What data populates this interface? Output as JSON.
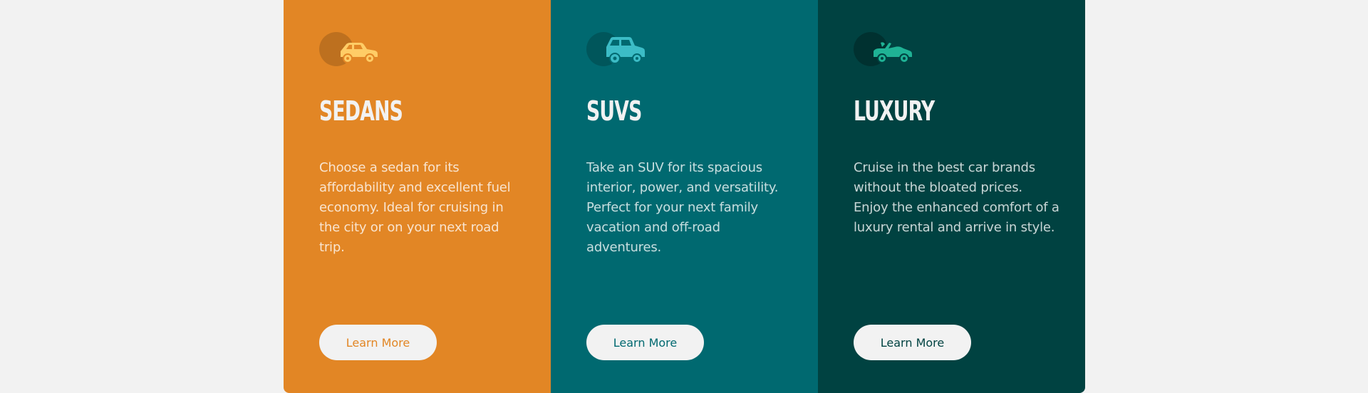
{
  "cards": [
    {
      "id": "sedans",
      "icon": "sedan-car-icon",
      "title": "SEDANS",
      "text": "Choose a sedan for its affordability and excellent fuel economy. Ideal for cruising in the city or on your next road trip.",
      "button_label": "Learn More",
      "color": "#e28625",
      "icon_color": "#ffcc66"
    },
    {
      "id": "suvs",
      "icon": "suv-car-icon",
      "title": "SUVS",
      "text": "Take an SUV for its spacious interior, power, and versatility. Perfect for your next family vacation and off-road adventures.",
      "button_label": "Learn More",
      "color": "#006970",
      "icon_color": "#3cbcc6"
    },
    {
      "id": "luxury",
      "icon": "luxury-car-icon",
      "title": "LUXURY",
      "text": "Cruise in the best car brands without the bloated prices. Enjoy the enhanced comfort of a luxury rental and arrive in style.",
      "button_label": "Learn More",
      "color": "#004241",
      "icon_color": "#1fb295"
    }
  ],
  "page_background": "#f2f2f2"
}
